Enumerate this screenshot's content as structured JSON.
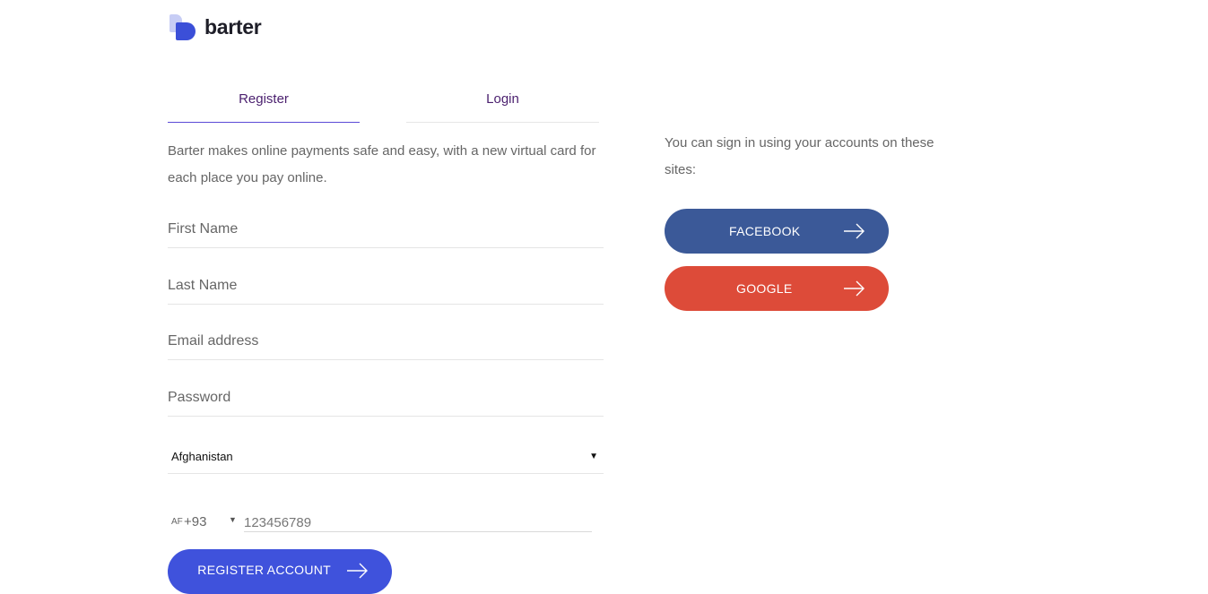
{
  "brand": {
    "name": "barter"
  },
  "tabs": [
    {
      "label": "Register",
      "active": true
    },
    {
      "label": "Login",
      "active": false
    }
  ],
  "intro": "Barter makes online payments safe and easy, with a new virtual card for each place you pay online.",
  "form": {
    "first_name_placeholder": "First Name",
    "last_name_placeholder": "Last Name",
    "email_placeholder": "Email address",
    "password_placeholder": "Password",
    "country_value": "Afghanistan",
    "phone_flag": "AF",
    "phone_code": "+93",
    "phone_placeholder": "123456789",
    "submit_label": "REGISTER ACCOUNT"
  },
  "social": {
    "text": "You can sign in using your accounts on these sites:",
    "facebook_label": "FACEBOOK",
    "google_label": "GOOGLE"
  },
  "colors": {
    "accent": "#3f52dc",
    "tab_text": "#4a1f6e",
    "facebook": "#3b5998",
    "google": "#dd4b39"
  },
  "icons": {
    "arrow": "arrow-right-icon",
    "caret": "caret-down-icon"
  }
}
